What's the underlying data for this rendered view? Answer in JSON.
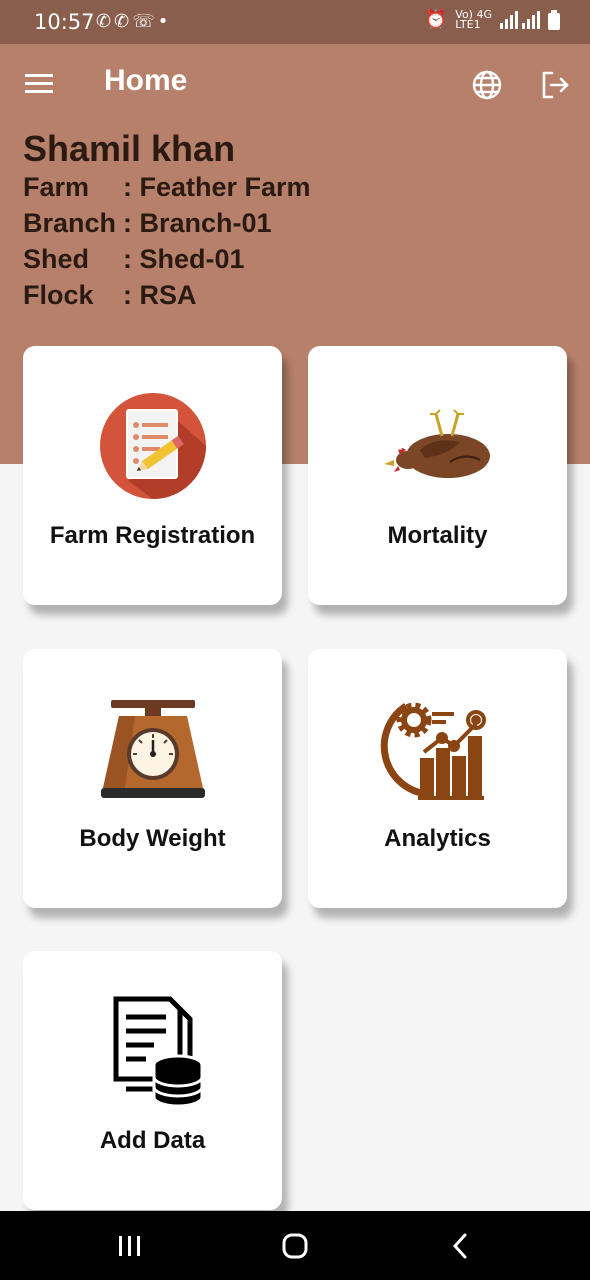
{
  "status": {
    "time": "10:57",
    "network_label_top": "Vo) 4G",
    "network_label_bottom": "LTE1"
  },
  "appbar": {
    "title": "Home",
    "icons": [
      "menu-icon",
      "globe-icon",
      "logout-icon"
    ]
  },
  "profile": {
    "name": "Shamil khan",
    "rows": [
      {
        "label": "Farm",
        "value": ": Feather Farm"
      },
      {
        "label": "Branch",
        "value": ": Branch-01"
      },
      {
        "label": "Shed",
        "value": ": Shed-01"
      },
      {
        "label": "Flock",
        "value": ": RSA"
      }
    ]
  },
  "cards": [
    {
      "label": "Farm Registration",
      "icon": "registration-icon"
    },
    {
      "label": "Mortality",
      "icon": "dead-chicken-icon"
    },
    {
      "label": "Body Weight",
      "icon": "weighing-scale-icon"
    },
    {
      "label": "Analytics",
      "icon": "analytics-icon"
    },
    {
      "label": "Add Data",
      "icon": "add-data-icon"
    }
  ],
  "colors": {
    "status_bar": "#8a5e4d",
    "header": "#b7806b",
    "text_dark": "#2b1a12",
    "accent_brown": "#8b4513"
  }
}
